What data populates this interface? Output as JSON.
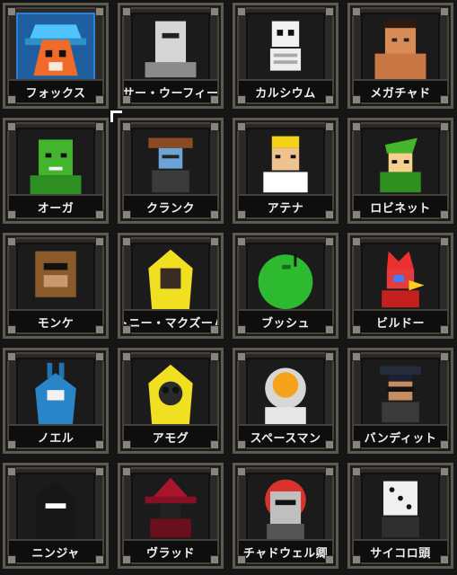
{
  "characters": [
    {
      "name": "フォックス",
      "icon": "fox-portrait-icon",
      "selected": true
    },
    {
      "name": "サー・ウーフィー",
      "icon": "knight-helmet-portrait-icon",
      "selected": false
    },
    {
      "name": "カルシウム",
      "icon": "skeleton-portrait-icon",
      "selected": false
    },
    {
      "name": "メガチャド",
      "icon": "muscle-man-portrait-icon",
      "selected": false
    },
    {
      "name": "オーガ",
      "icon": "ogre-portrait-icon",
      "selected": false
    },
    {
      "name": "クランク",
      "icon": "cowboy-robot-portrait-icon",
      "selected": false
    },
    {
      "name": "アテナ",
      "icon": "athena-portrait-icon",
      "selected": false
    },
    {
      "name": "ロビネット",
      "icon": "robin-hood-portrait-icon",
      "selected": false
    },
    {
      "name": "モンケ",
      "icon": "monkey-portrait-icon",
      "selected": false
    },
    {
      "name": "トニー・マクズーム",
      "icon": "yellow-hood-portrait-icon",
      "selected": false
    },
    {
      "name": "ブッシュ",
      "icon": "bush-portrait-icon",
      "selected": false
    },
    {
      "name": "ビルドー",
      "icon": "bird-portrait-icon",
      "selected": false
    },
    {
      "name": "ノエル",
      "icon": "blue-rabbit-hood-portrait-icon",
      "selected": false
    },
    {
      "name": "アモグ",
      "icon": "gas-mask-portrait-icon",
      "selected": false
    },
    {
      "name": "スペースマン",
      "icon": "astronaut-portrait-icon",
      "selected": false
    },
    {
      "name": "バンディット",
      "icon": "bandit-portrait-icon",
      "selected": false
    },
    {
      "name": "ニンジャ",
      "icon": "ninja-portrait-icon",
      "selected": false
    },
    {
      "name": "ヴラッド",
      "icon": "vampire-portrait-icon",
      "selected": false
    },
    {
      "name": "チャドウェル卿",
      "icon": "armored-knight-portrait-icon",
      "selected": false
    },
    {
      "name": "サイコロ頭",
      "icon": "dice-head-portrait-icon",
      "selected": false
    }
  ],
  "colors": {
    "frame": "#5d5a53",
    "selected_bg": "#1f5f9f",
    "label_bg": "#0e0e0e",
    "label_text": "#f0f0f0"
  }
}
